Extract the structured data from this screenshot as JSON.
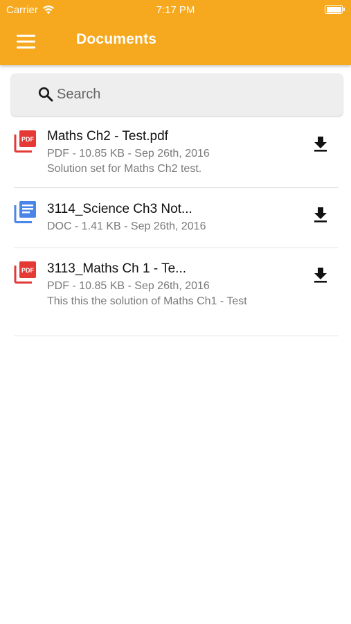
{
  "status_bar": {
    "carrier": "Carrier",
    "time": "7:17 PM",
    "wifi_icon": "wifi-icon",
    "battery_icon": "battery-icon"
  },
  "header": {
    "title": "Documents",
    "menu_icon": "hamburger-menu-icon",
    "background": "#F6A81E"
  },
  "search": {
    "placeholder": "Search",
    "value": ""
  },
  "documents": [
    {
      "type": "pdf",
      "icon": "pdf-file-icon",
      "name": "Maths Ch2 - Test.pdf",
      "meta": "PDF - 10.85 KB - Sep 26th, 2016",
      "description": "Solution set for Maths Ch2 test."
    },
    {
      "type": "doc",
      "icon": "doc-file-icon",
      "name": "3114_Science Ch3 Not...",
      "meta": "DOC - 1.41 KB - Sep 26th, 2016",
      "description": ""
    },
    {
      "type": "pdf",
      "icon": "pdf-file-icon",
      "name": "3113_Maths Ch 1 - Te...",
      "meta": "PDF - 10.85 KB - Sep 26th, 2016",
      "description": "This this the solution of Maths Ch1 - Test"
    }
  ],
  "colors": {
    "accent": "#F6A81E",
    "pdf_red": "#E53935",
    "doc_blue": "#4A86E8"
  }
}
